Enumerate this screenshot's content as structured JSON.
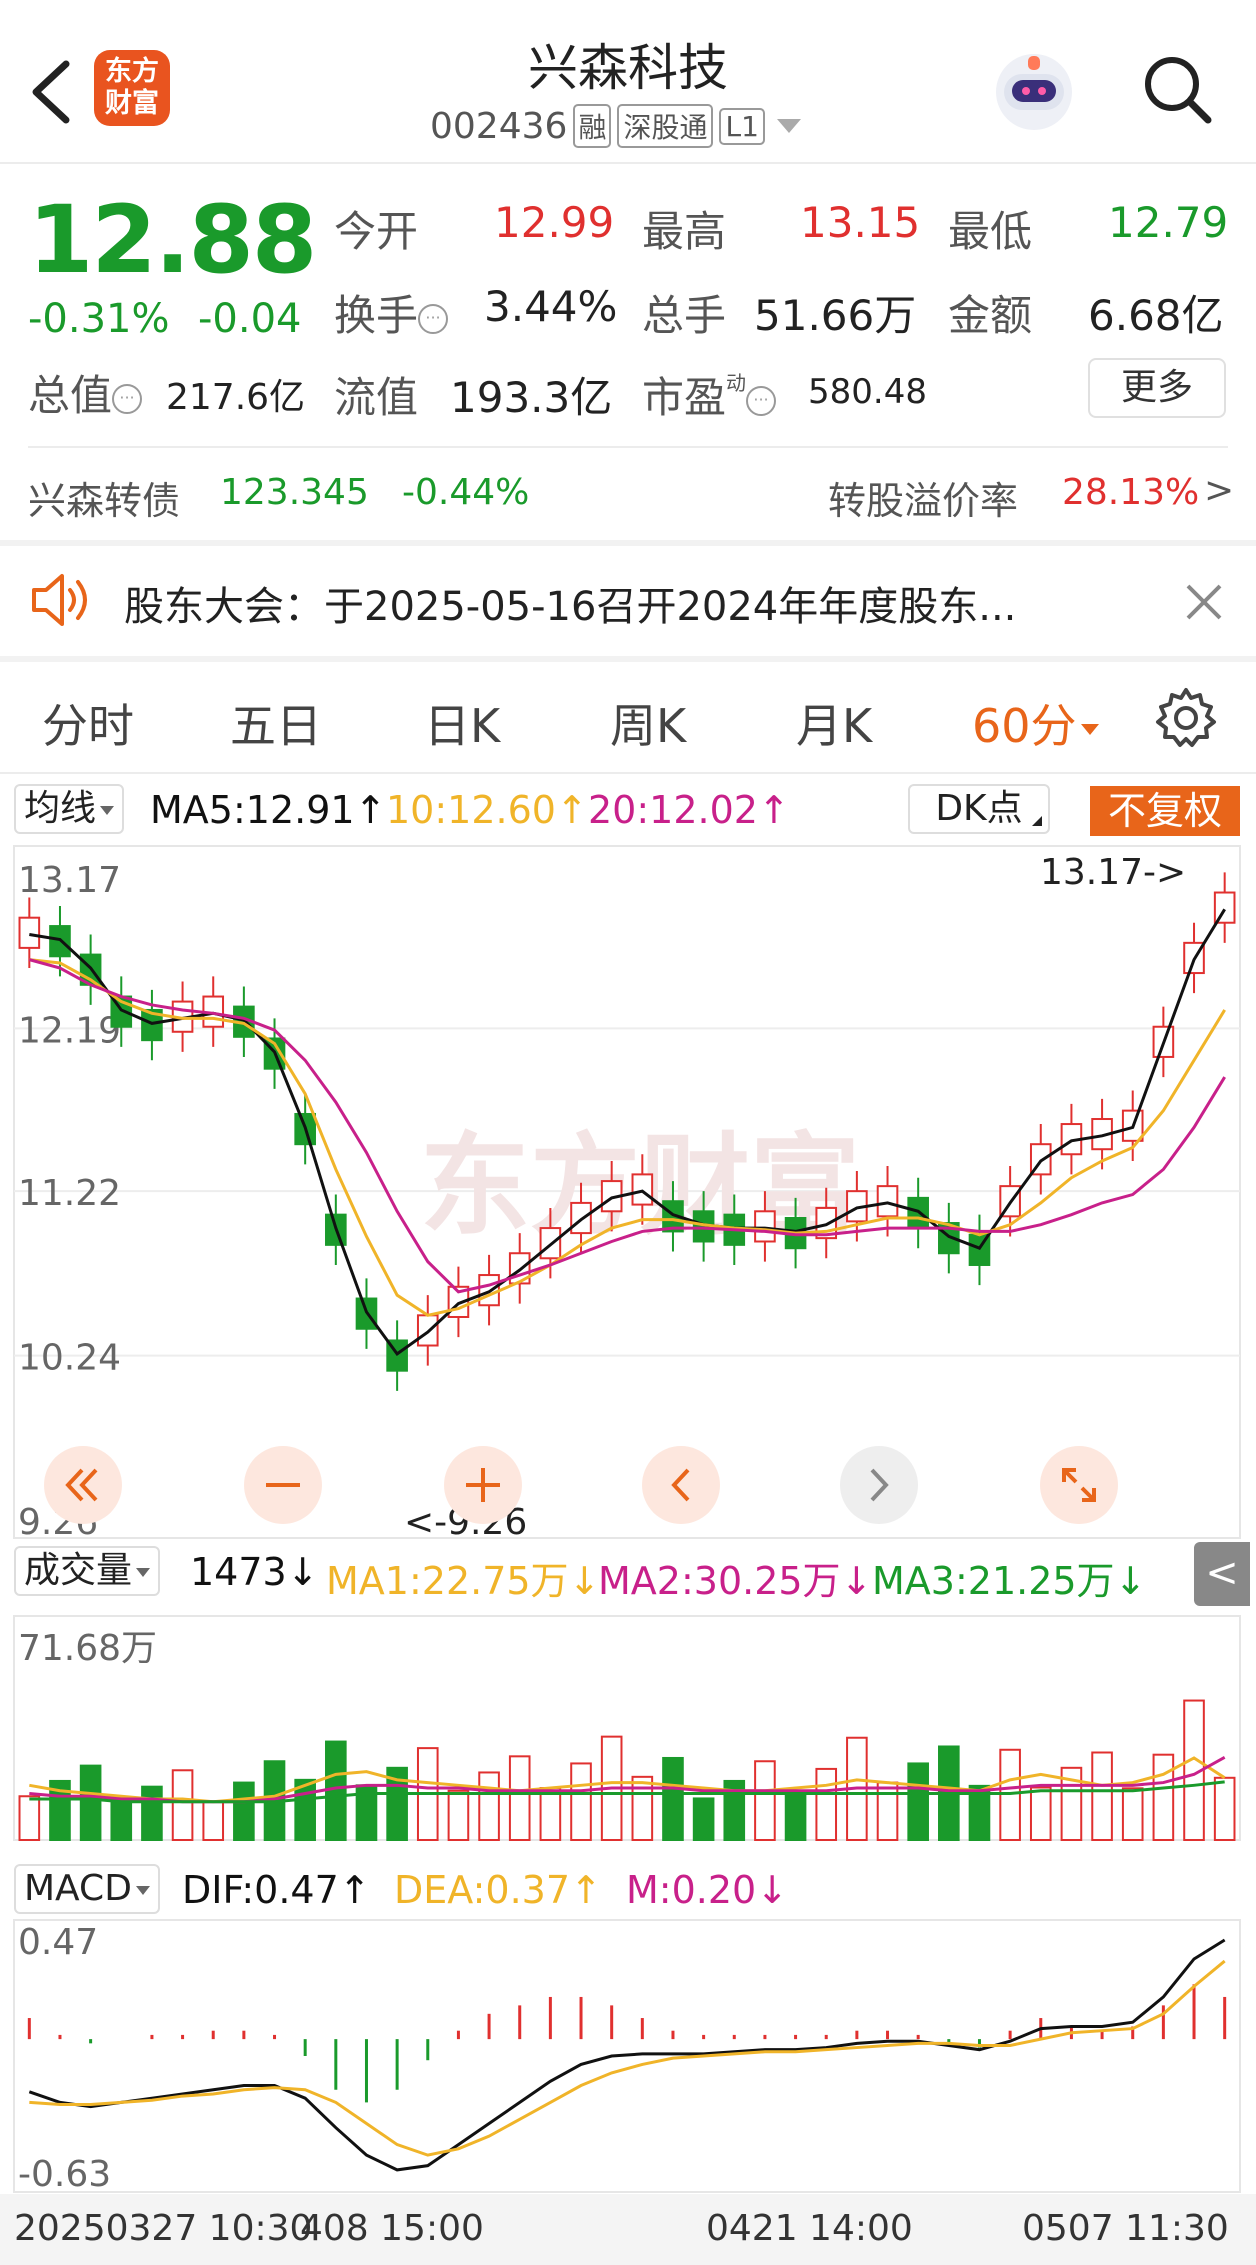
{
  "header": {
    "app_logo": "东方\n财富",
    "logo_line1": "东方",
    "logo_line2": "财富",
    "stock_name": "兴森科技",
    "stock_code": "002436",
    "tag_rong": "融",
    "tag_hgt": "深股通",
    "tag_l1": "L1"
  },
  "quote": {
    "price": "12.88",
    "change_pct": "-0.31%",
    "change": "-0.04",
    "open_label": "今开",
    "open": "12.99",
    "high_label": "最高",
    "high": "13.15",
    "low_label": "最低",
    "low": "12.79",
    "turnover_label": "换手",
    "turnover": "3.44%",
    "volume_label": "总手",
    "volume": "51.66万",
    "amount_label": "金额",
    "amount": "6.68亿",
    "mktcap_label": "总值",
    "mktcap": "217.6亿",
    "float_label": "流值",
    "float": "193.3亿",
    "pe_label": "市盈",
    "pe_sup": "动",
    "pe": "580.48",
    "more_button": "更多"
  },
  "bond": {
    "name": "兴森转债",
    "price": "123.345",
    "change": "-0.44%",
    "premium_label": "转股溢价率",
    "premium": "28.13%",
    "arrow": ">"
  },
  "notice": {
    "text": "股东大会：于2025-05-16召开2024年年度股东..."
  },
  "tabs": [
    "分时",
    "五日",
    "日K",
    "周K",
    "月K",
    "60分"
  ],
  "chart_header": {
    "ma_select": "均线",
    "ma5": "MA5:12.91↑",
    "ma10": "10:12.60↑",
    "ma20": "20:12.02↑",
    "dk_button": "DK点",
    "fq_button": "不复权"
  },
  "volume_header": {
    "select": "成交量",
    "v": "1473↓",
    "ma1": "MA1:22.75万↓",
    "ma2": "MA2:30.25万↓",
    "ma3": "MA3:21.25万↓",
    "collapse": "<"
  },
  "macd_header": {
    "select": "MACD",
    "dif": "DIF:0.47↑",
    "dea": "DEA:0.37↑",
    "m": "M:0.20↓"
  },
  "colors": {
    "up": "#e0302f",
    "down": "#1a9a2b",
    "ma5": "#111111",
    "ma10": "#f0b429",
    "ma20": "#c8208a",
    "accent": "#e8651a"
  },
  "chart_data": [
    {
      "type": "candlestick",
      "title": "",
      "y_tick_labels": [
        "13.17",
        "12.19",
        "11.22",
        "10.24",
        "9.26"
      ],
      "ylim": [
        9.26,
        13.17
      ],
      "max_label": "13.17->",
      "min_label": "<-9.26",
      "series": [
        {
          "name": "MA5",
          "values": [
            12.75,
            12.72,
            12.55,
            12.3,
            12.22,
            12.25,
            12.28,
            12.24,
            12.05,
            11.6,
            11.0,
            10.5,
            10.25,
            10.38,
            10.55,
            10.62,
            10.75,
            10.9,
            11.05,
            11.18,
            11.22,
            11.08,
            11.02,
            11.0,
            11.0,
            10.98,
            11.02,
            11.12,
            11.15,
            11.1,
            10.95,
            10.88,
            11.15,
            11.4,
            11.52,
            11.55,
            11.6,
            12.1,
            12.6,
            12.9
          ]
        },
        {
          "name": "MA10",
          "values": [
            12.6,
            12.58,
            12.48,
            12.35,
            12.28,
            12.25,
            12.25,
            12.22,
            12.1,
            11.8,
            11.35,
            10.95,
            10.6,
            10.48,
            10.52,
            10.6,
            10.68,
            10.78,
            10.9,
            11.0,
            11.05,
            11.05,
            11.02,
            11.0,
            10.99,
            10.97,
            10.98,
            11.02,
            11.06,
            11.06,
            11.02,
            10.96,
            11.02,
            11.15,
            11.3,
            11.4,
            11.48,
            11.7,
            12.0,
            12.3
          ]
        },
        {
          "name": "MA20",
          "values": [
            12.6,
            12.55,
            12.45,
            12.38,
            12.33,
            12.3,
            12.28,
            12.25,
            12.18,
            12.0,
            11.75,
            11.45,
            11.1,
            10.8,
            10.62,
            10.66,
            10.72,
            10.78,
            10.85,
            10.92,
            10.98,
            11.0,
            11.0,
            10.99,
            10.98,
            10.96,
            10.96,
            10.98,
            11.0,
            11.0,
            11.0,
            10.98,
            10.98,
            11.02,
            11.08,
            11.15,
            11.2,
            11.35,
            11.6,
            11.9
          ]
        }
      ]
    },
    {
      "type": "bar",
      "title": "",
      "y_tick_labels": [
        "71.68万"
      ],
      "ylim": [
        0,
        71.68
      ],
      "series": [
        {
          "name": "MA1",
          "values": [
            20,
            18,
            17,
            16,
            15,
            15,
            14,
            15,
            16,
            20,
            24,
            25,
            22,
            21,
            20,
            19,
            18,
            19,
            20,
            21,
            21,
            20,
            19,
            18,
            18,
            19,
            20,
            22,
            21,
            20,
            19,
            18,
            22,
            24,
            22,
            20,
            21,
            24,
            30,
            22.75
          ]
        },
        {
          "name": "MA2",
          "values": [
            17,
            16,
            16,
            15,
            15,
            14,
            14,
            14,
            15,
            17,
            19,
            20,
            20,
            19,
            19,
            18,
            18,
            18,
            18,
            19,
            19,
            19,
            18,
            18,
            18,
            18,
            18,
            19,
            19,
            19,
            18,
            18,
            19,
            20,
            20,
            20,
            20,
            21,
            24,
            30.25
          ]
        },
        {
          "name": "MA3",
          "values": [
            15,
            15,
            15,
            14,
            14,
            14,
            14,
            14,
            14,
            15,
            16,
            17,
            17,
            17,
            17,
            17,
            17,
            17,
            17,
            17,
            17,
            17,
            17,
            17,
            17,
            17,
            17,
            17,
            17,
            17,
            17,
            17,
            17,
            18,
            18,
            18,
            18,
            19,
            20,
            21.25
          ]
        }
      ]
    },
    {
      "type": "line",
      "title": "",
      "y_tick_labels": [
        "0.47",
        "-0.63"
      ],
      "ylim": [
        -0.63,
        0.47
      ],
      "series": [
        {
          "name": "DIF",
          "values": [
            -0.25,
            -0.3,
            -0.32,
            -0.3,
            -0.28,
            -0.26,
            -0.24,
            -0.22,
            -0.22,
            -0.28,
            -0.42,
            -0.55,
            -0.62,
            -0.6,
            -0.5,
            -0.4,
            -0.3,
            -0.2,
            -0.12,
            -0.08,
            -0.07,
            -0.07,
            -0.07,
            -0.06,
            -0.05,
            -0.05,
            -0.04,
            -0.02,
            -0.01,
            -0.01,
            -0.03,
            -0.05,
            -0.01,
            0.05,
            0.06,
            0.06,
            0.08,
            0.2,
            0.38,
            0.47
          ]
        },
        {
          "name": "DEA",
          "values": [
            -0.3,
            -0.31,
            -0.31,
            -0.3,
            -0.29,
            -0.27,
            -0.26,
            -0.24,
            -0.23,
            -0.24,
            -0.3,
            -0.4,
            -0.5,
            -0.55,
            -0.52,
            -0.46,
            -0.38,
            -0.3,
            -0.22,
            -0.16,
            -0.12,
            -0.09,
            -0.08,
            -0.07,
            -0.06,
            -0.06,
            -0.05,
            -0.04,
            -0.03,
            -0.02,
            -0.02,
            -0.03,
            -0.03,
            0.0,
            0.03,
            0.04,
            0.05,
            0.12,
            0.25,
            0.37
          ]
        }
      ]
    }
  ],
  "x_axis_labels": [
    "20250327 10:30",
    "408 15:00",
    "0421 14:00",
    "0507 11:30"
  ]
}
